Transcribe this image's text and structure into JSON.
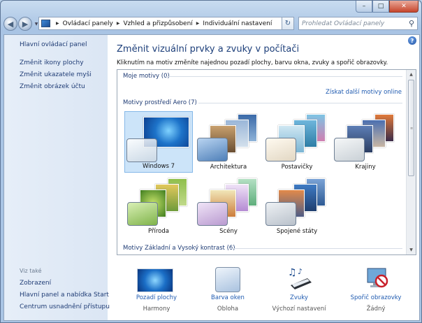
{
  "window": {
    "controls": {
      "minimize": "–",
      "maximize": "□",
      "close": "✕"
    }
  },
  "nav": {
    "breadcrumbs": [
      "Ovládací panely",
      "Vzhled a přizpůsobení",
      "Individuální nastavení"
    ],
    "search_placeholder": "Prohledat Ovládací panely"
  },
  "sidebar": {
    "home": "Hlavní ovládací panel",
    "links": [
      "Změnit ikony plochy",
      "Změnit ukazatele myši",
      "Změnit obrázek účtu"
    ],
    "see_also_title": "Viz také",
    "see_also": [
      "Zobrazení",
      "Hlavní panel a nabídka Start",
      "Centrum usnadnění přístupu"
    ]
  },
  "main": {
    "title": "Změnit vizuální prvky a zvuky v počítači",
    "description": "Kliknutím na motiv změníte najednou pozadí plochy, barvu okna, zvuky a spořič obrazovky.",
    "my_themes": "Moje motivy (0)",
    "online_link": "Získat další motivy online",
    "aero_group": "Motivy prostředí Aero (7)",
    "basic_group": "Motivy Základní a Vysoký kontrast (6)",
    "themes": [
      {
        "label": "Windows 7",
        "selected": true
      },
      {
        "label": "Architektura",
        "selected": false
      },
      {
        "label": "Postavičky",
        "selected": false
      },
      {
        "label": "Krajiny",
        "selected": false
      },
      {
        "label": "Příroda",
        "selected": false
      },
      {
        "label": "Scény",
        "selected": false
      },
      {
        "label": "Spojené státy",
        "selected": false
      }
    ]
  },
  "bottom": [
    {
      "link": "Pozadí plochy",
      "value": "Harmony",
      "icon": "desktop-background-icon"
    },
    {
      "link": "Barva oken",
      "value": "Obloha",
      "icon": "window-color-icon"
    },
    {
      "link": "Zvuky",
      "value": "Výchozí nastavení",
      "icon": "sounds-icon"
    },
    {
      "link": "Spořič obrazovky",
      "value": "Žádný",
      "icon": "screensaver-icon"
    }
  ],
  "colors": {
    "link": "#1e5ab0",
    "title": "#1d3f7a",
    "selection": "#cce4f9"
  }
}
